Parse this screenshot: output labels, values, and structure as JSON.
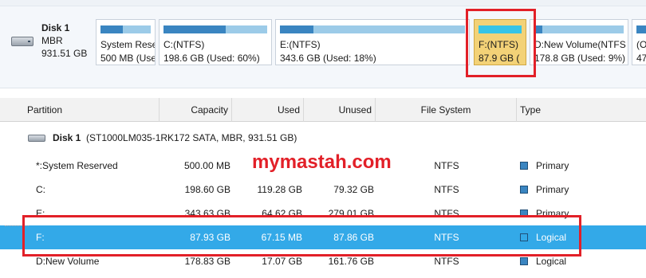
{
  "disk_map": {
    "disk": {
      "name": "Disk 1",
      "type": "MBR",
      "size": "931.51 GB"
    },
    "partitions": [
      {
        "label": "System Rese",
        "detail": "500 MB (Use",
        "used_fraction": 0.45,
        "selected": false
      },
      {
        "label": "C:(NTFS)",
        "detail": "198.6 GB (Used: 60%)",
        "used_fraction": 0.6,
        "selected": false
      },
      {
        "label": "E:(NTFS)",
        "detail": "343.6 GB (Used: 18%)",
        "used_fraction": 0.18,
        "selected": false
      },
      {
        "label": "F:(NTFS)",
        "detail": "87.9 GB (",
        "used_fraction": 0.0,
        "selected": true
      },
      {
        "label": "D:New Volume(NTFS",
        "detail": "178.8 GB (Used: 9%)",
        "used_fraction": 0.09,
        "selected": false
      },
      {
        "label": "(O",
        "detail": "47",
        "used_fraction": 1.0,
        "selected": false
      }
    ]
  },
  "table": {
    "columns": {
      "partition": "Partition",
      "capacity": "Capacity",
      "used": "Used",
      "unused": "Unused",
      "file_system": "File System",
      "type": "Type"
    },
    "disk_row": {
      "name": "Disk 1",
      "details": "(ST1000LM035-1RK172 SATA, MBR, 931.51 GB)"
    },
    "rows": [
      {
        "partition": "*:System Reserved",
        "capacity": "500.00 MB",
        "used": "",
        "unused": "",
        "file_system": "NTFS",
        "type": "Primary"
      },
      {
        "partition": "C:",
        "capacity": "198.60 GB",
        "used": "119.28 GB",
        "unused": "79.32 GB",
        "file_system": "NTFS",
        "type": "Primary"
      },
      {
        "partition": "E:",
        "capacity": "343.63 GB",
        "used": "64.62 GB",
        "unused": "279.01 GB",
        "file_system": "NTFS",
        "type": "Primary"
      },
      {
        "partition": "F:",
        "capacity": "87.93 GB",
        "used": "67.15 MB",
        "unused": "87.86 GB",
        "file_system": "NTFS",
        "type": "Logical"
      },
      {
        "partition": "D:New Volume",
        "capacity": "178.83 GB",
        "used": "17.07 GB",
        "unused": "161.76 GB",
        "file_system": "NTFS",
        "type": "Logical"
      }
    ],
    "selected_row": 3
  },
  "watermark": "mymastah.com",
  "colors": {
    "selection": "#33a9e8",
    "highlight_box": "#e22028",
    "partition_selected": "#f3d277",
    "used_bar": "#3a85c1"
  }
}
